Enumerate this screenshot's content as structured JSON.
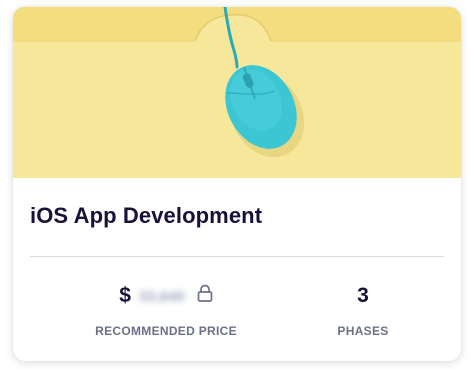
{
  "card": {
    "title": "iOS App Development",
    "image_icon": "computer-mouse-icon",
    "price": {
      "currency_symbol": "$",
      "amount_hidden": "33,640",
      "lock_icon": "lock-icon",
      "label": "RECOMMENDED PRICE"
    },
    "phases": {
      "count": "3",
      "label": "PHASES"
    }
  },
  "colors": {
    "hero_background": "#f6e79a",
    "mouse": "#3cc6d4",
    "title_text": "#16123a",
    "label_text": "#6b7088"
  }
}
